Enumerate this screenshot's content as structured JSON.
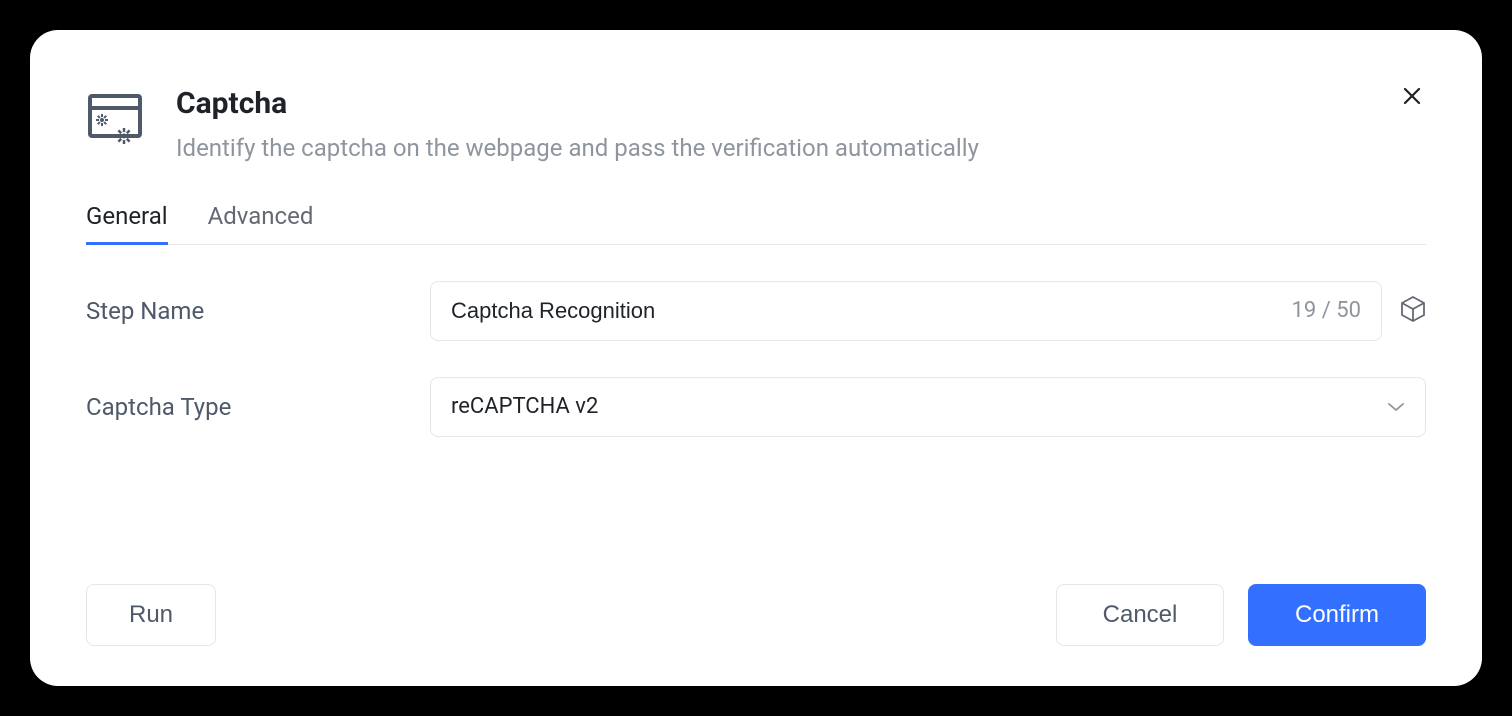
{
  "dialog": {
    "title": "Captcha",
    "subtitle": "Identify the captcha on the webpage and pass the verification automatically"
  },
  "tabs": {
    "general": "General",
    "advanced": "Advanced",
    "active": "general"
  },
  "form": {
    "stepName": {
      "label": "Step Name",
      "value": "Captcha Recognition",
      "charCount": "19 / 50"
    },
    "captchaType": {
      "label": "Captcha Type",
      "value": "reCAPTCHA v2"
    }
  },
  "footer": {
    "run": "Run",
    "cancel": "Cancel",
    "confirm": "Confirm"
  }
}
